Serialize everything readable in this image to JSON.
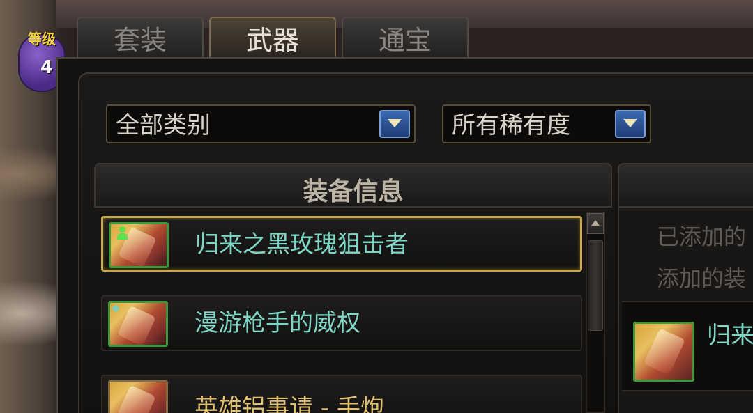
{
  "hud": {
    "level_label": "等级",
    "level_value": "4"
  },
  "tabs": [
    {
      "label": "套装",
      "active": false
    },
    {
      "label": "武器",
      "active": true
    },
    {
      "label": "通宝",
      "active": false
    }
  ],
  "filters": {
    "category": "全部类别",
    "rarity": "所有稀有度"
  },
  "equipment_panel": {
    "header": "装备信息",
    "items": [
      {
        "name": "归来之黑玫瑰狙击者",
        "selected": true,
        "owned_marker": true
      },
      {
        "name": "漫游枪手的威权",
        "selected": false,
        "owned_marker": false
      },
      {
        "name": "英雄铝事请 - 手炮",
        "selected": false,
        "owned_marker": false
      }
    ]
  },
  "added_panel": {
    "line1": "已添加的",
    "line2": "添加的装",
    "slot_item_name": "归来"
  },
  "colors": {
    "item_name": "#7ed6c6",
    "selected_border": "#c8a84a",
    "icon_border": "#3c9a3a"
  }
}
